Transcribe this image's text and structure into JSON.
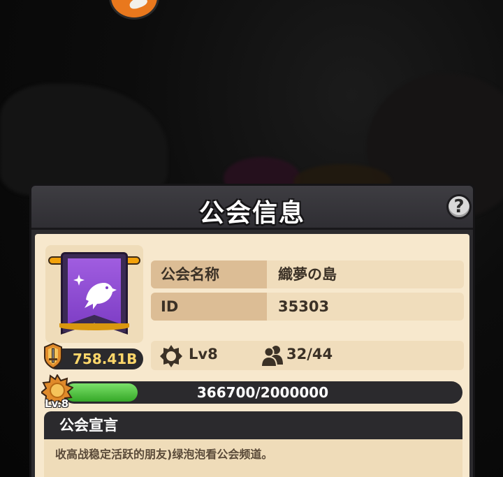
{
  "panel": {
    "title": "公会信息",
    "help_label": "?"
  },
  "guild": {
    "name_label": "公会名称",
    "name_value": "織夢の島",
    "id_label": "ID",
    "id_value": "35303",
    "power": "758.41B",
    "level": "Lv8",
    "members": "32/44",
    "exp_text": "366700/2000000",
    "exp_fraction": 0.1834,
    "level_badge": "Lv.8"
  },
  "declaration": {
    "title": "公会宣言",
    "text": "收高战稳定活跃的朋友)绿泡泡看公会频道。"
  },
  "icons": {
    "emblem": "purple-banner-bird-icon",
    "power": "sword-shield-icon",
    "level": "gear-badge-icon",
    "members": "members-icon",
    "help": "question-mark-icon"
  },
  "colors": {
    "panel_bg": "#f7e8cd",
    "label_bg": "#dcbd95",
    "exp_fill": "#35a827",
    "power_text": "#ffd76a",
    "banner": "#8a48d0"
  }
}
